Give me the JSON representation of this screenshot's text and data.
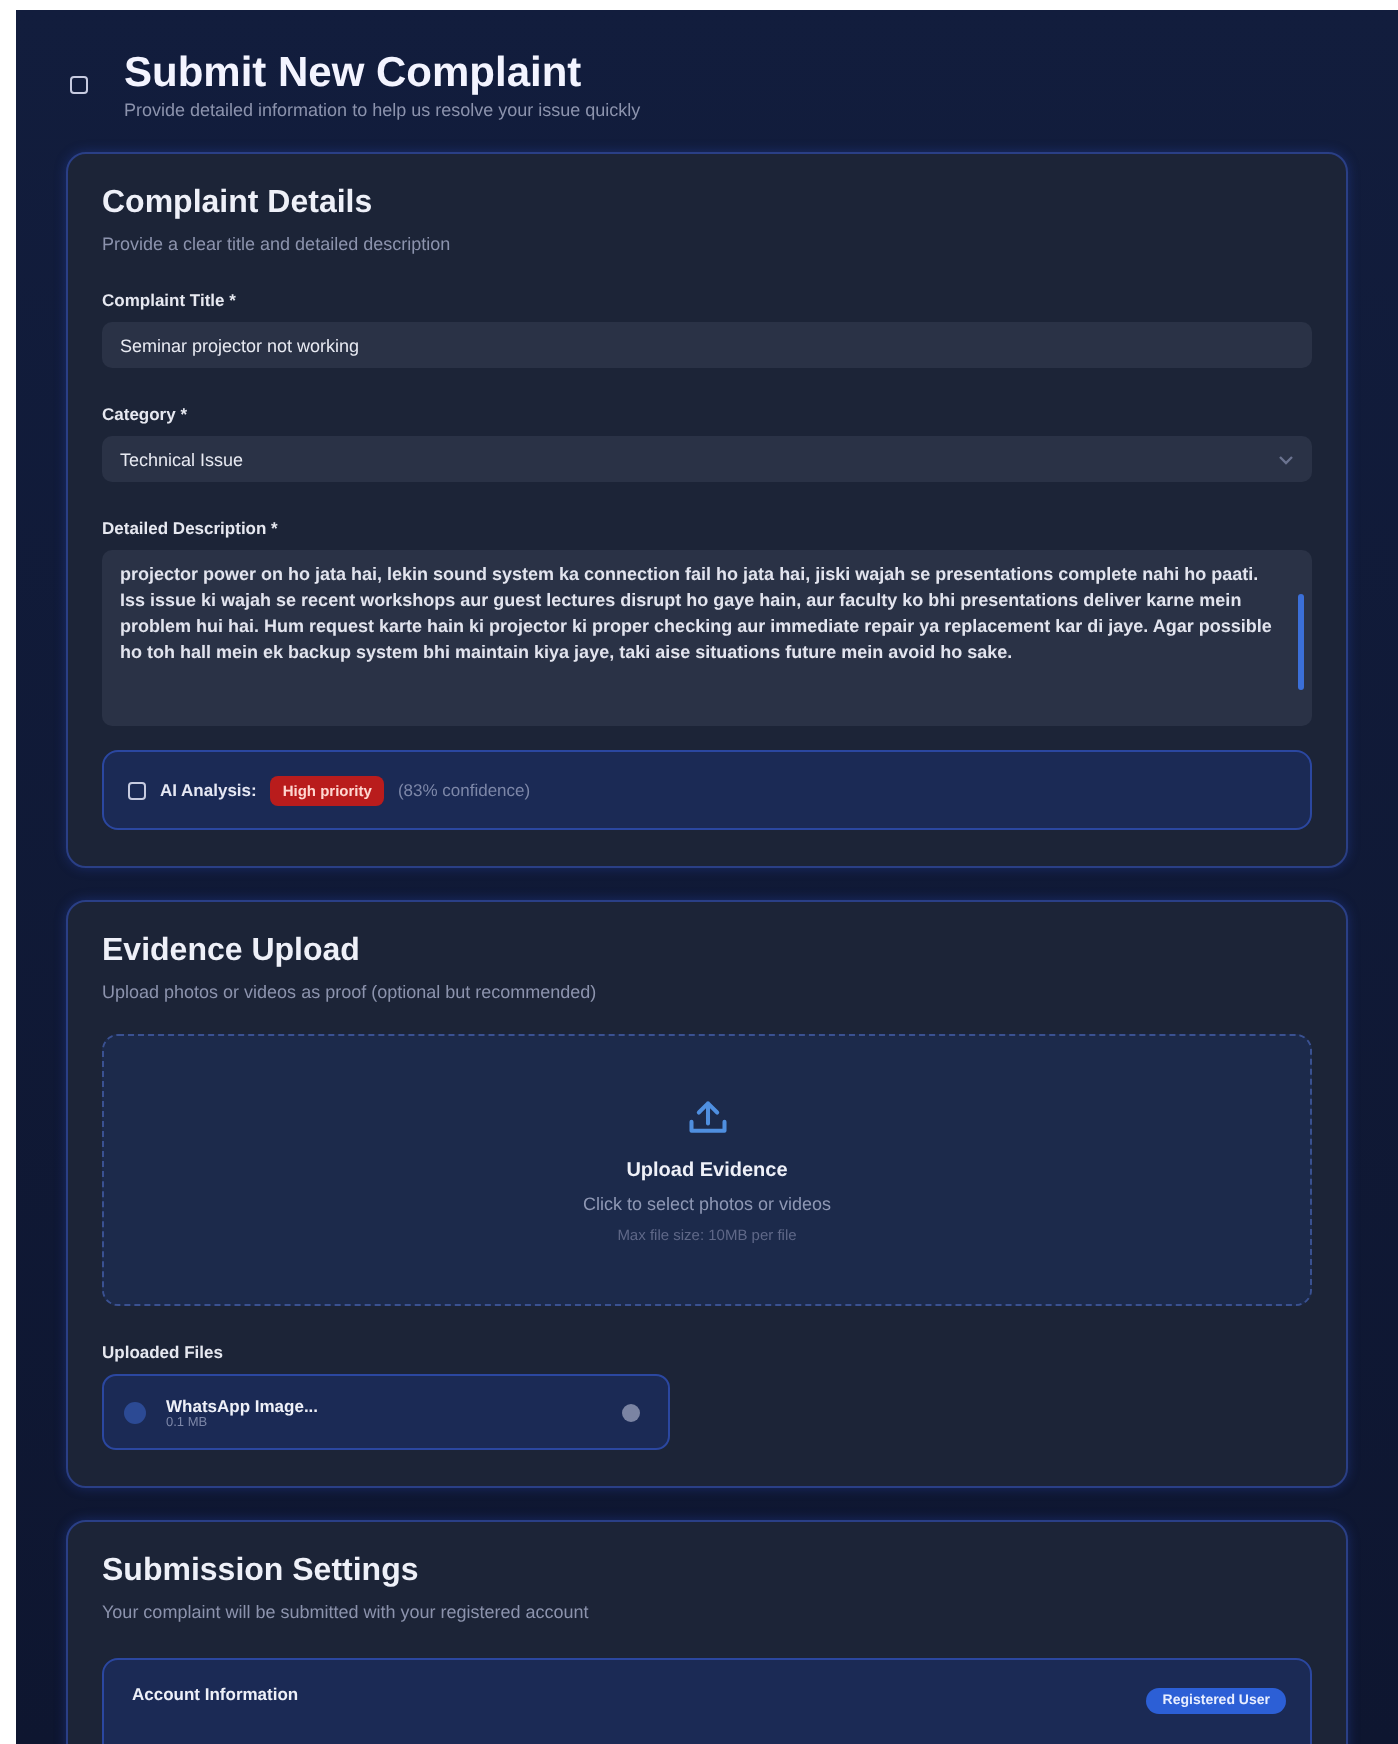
{
  "header": {
    "title": "Submit New Complaint",
    "subtitle": "Provide detailed information to help us resolve your issue quickly"
  },
  "details": {
    "title": "Complaint Details",
    "subtitle": "Provide a clear title and detailed description",
    "fields": [
      {
        "kind": "text",
        "label": "Complaint Title *",
        "value": "Seminar projector not working"
      },
      {
        "kind": "select",
        "label": "Category *",
        "value": "Technical Issue"
      },
      {
        "kind": "textarea",
        "label": "Detailed Description *",
        "value": "projector power on ho jata hai, lekin sound system ka connection fail ho jata hai, jiski wajah se presentations complete nahi ho paati. Iss issue ki wajah se recent workshops aur guest lectures disrupt ho gaye hain, aur faculty ko bhi presentations deliver karne mein problem hui hai. Hum request karte hain ki projector ki proper checking aur immediate repair ya replacement kar di jaye. Agar possible ho toh hall mein ek backup system bhi maintain kiya jaye, taki aise situations future mein avoid ho sake."
      }
    ],
    "analysis": {
      "label": "AI Analysis:",
      "badge": "High priority",
      "confidence": "(83% confidence)"
    }
  },
  "evidence": {
    "title": "Evidence Upload",
    "subtitle": "Upload photos or videos as proof (optional but recommended)",
    "dropzone": {
      "title": "Upload Evidence",
      "hint": "Click to select photos or videos",
      "limit": "Max file size: 10MB per file"
    },
    "files_label": "Uploaded Files",
    "files": [
      {
        "name": "WhatsApp Image...",
        "size": "0.1 MB"
      }
    ]
  },
  "settings": {
    "title": "Submission Settings",
    "subtitle": "Your complaint will be submitted with your registered account",
    "account": {
      "title": "Account Information",
      "badge": "Registered User"
    }
  }
}
